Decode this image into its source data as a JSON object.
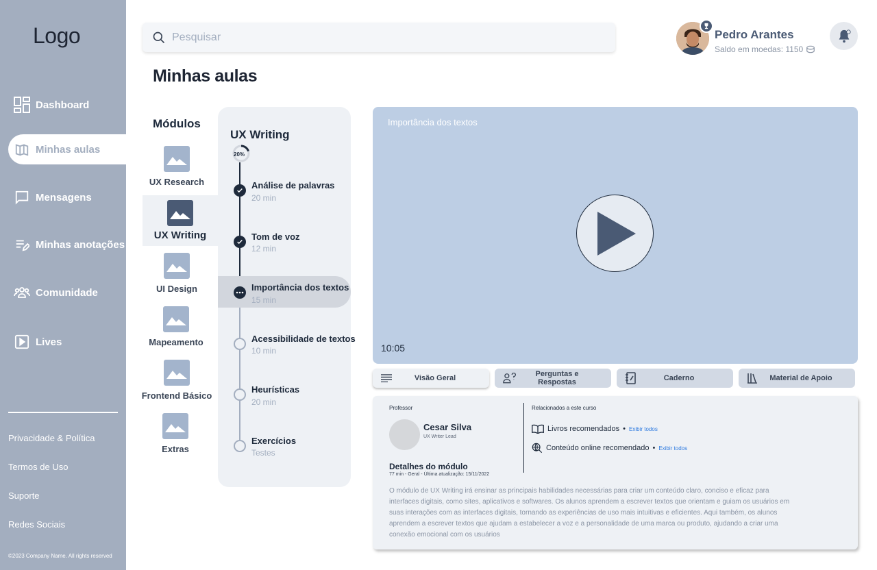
{
  "brand": {
    "logo": "Logo"
  },
  "sidebar": {
    "items": [
      {
        "label": "Dashboard",
        "icon": "dashboard-icon"
      },
      {
        "label": "Minhas aulas",
        "icon": "lessons-icon",
        "active": true
      },
      {
        "label": "Mensagens",
        "icon": "message-icon"
      },
      {
        "label": "Minhas anotações",
        "icon": "notes-icon"
      },
      {
        "label": "Comunidade",
        "icon": "community-icon"
      },
      {
        "label": "Lives",
        "icon": "play-square-icon"
      }
    ],
    "footer_links": [
      "Privacidade & Política",
      "Termos de Uso",
      "Suporte",
      "Redes Sociais"
    ],
    "copyright": "©2023 Company Name. All rights reserved"
  },
  "header": {
    "search_placeholder": "Pesquisar",
    "user": {
      "name": "Pedro Arantes",
      "balance": "Saldo em moedas: 1150"
    }
  },
  "page": {
    "title": "Minhas aulas"
  },
  "modules": {
    "heading": "Módulos",
    "items": [
      "UX Research",
      "UX Writing",
      "UI Design",
      "Mapeamento",
      "Frontend Básico",
      "Extras"
    ],
    "active": "UX Writing"
  },
  "lessons": {
    "title": "UX Writing",
    "progress": "20%",
    "progress_fraction": 0.2,
    "items": [
      {
        "name": "Análise de palavras",
        "duration": "20 min",
        "status": "done"
      },
      {
        "name": "Tom de voz",
        "duration": "12 min",
        "status": "done"
      },
      {
        "name": "Importância dos textos",
        "duration": "15 min",
        "status": "current"
      },
      {
        "name": "Acessibilidade de textos",
        "duration": "10 min",
        "status": "todo"
      },
      {
        "name": "Heurísticas",
        "duration": "20 min",
        "status": "todo"
      },
      {
        "name": "Exercícios",
        "duration": "Testes",
        "status": "todo"
      }
    ]
  },
  "video": {
    "title": "Importância dos textos",
    "time": "10:05"
  },
  "tabs": [
    {
      "label": "Visão Geral",
      "icon": "list-icon",
      "active": true
    },
    {
      "label": "Perguntas e Respostas",
      "icon": "question-user-icon"
    },
    {
      "label": "Caderno",
      "icon": "notebook-icon"
    },
    {
      "label": "Material de Apoio",
      "icon": "library-icon"
    }
  ],
  "details": {
    "professor_label": "Professor",
    "professor_name": "Cesar Silva",
    "professor_role": "UX Writer Lead",
    "module_title": "Detalhes do módulo",
    "module_meta": "77 min - Geral - Última atualização: 15/11/2022",
    "related_label": "Relacionados a este curso",
    "related": [
      {
        "label": "Livros recomendados",
        "link": "Exibir todos",
        "icon": "book-icon"
      },
      {
        "label": "Conteúdo online recomendado",
        "link": "Exibir todos",
        "icon": "globe-search-icon"
      }
    ],
    "description": "O módulo de UX Writing irá ensinar as principais habilidades necessárias para criar um conteúdo claro, conciso e eficaz para interfaces digitais, como sites, aplicativos e softwares.  Os alunos aprendem a escrever textos que orientam e guiam os usuários em suas interações com as interfaces digitais, tornando as experiências de uso mais intuitivas e eficientes. Aqui também, os alunos aprendem a escrever textos que ajudam a estabelecer a voz e a personalidade de uma marca ou produto, ajudando a criar uma conexão emocional com os usuários"
  },
  "colors": {
    "sidebar": "#a3aebf",
    "accent": "#4a5a74",
    "video_bg": "#bdcee4",
    "link": "#2f7be0"
  }
}
